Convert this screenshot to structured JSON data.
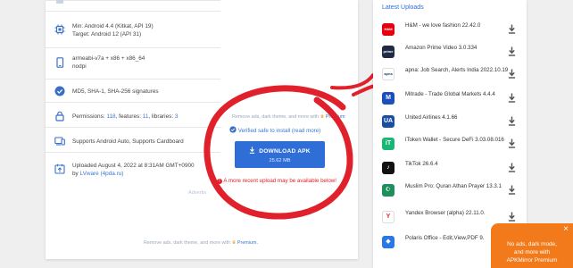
{
  "details": {
    "min_android": "Min: Android 4.4 (Kitkat, API 19)",
    "target_android": "Target: Android 12 (API 31)",
    "arch": "armeabi-v7a + x86 + x86_64",
    "dpi": "nodpi",
    "signatures": "MD5, SHA-1, SHA-256 signatures",
    "permissions_prefix": "Permissions: ",
    "permissions_count": "118",
    "features_prefix": ", features: ",
    "features_count": "11",
    "libraries_prefix": ", libraries: ",
    "libraries_count": "3",
    "auto": "Supports Android Auto, Supports Cardboard",
    "uploaded": "Uploaded August 4, 2022 at 8:31AM GMT+0900",
    "uploaded_by": "by LVware (4pda.ru)",
    "advert": "Advertis"
  },
  "download": {
    "remove_ads_top": "Remove ads, dark theme, and more with",
    "premium_top": "Premium",
    "verified": "Verified safe to install (read more)",
    "button_label": "DOWNLOAD APK",
    "file_size": "25.62 MB",
    "warning": "A more recent upload may be available below!",
    "remove_ads_bottom": "Remove ads, dark theme, and more with",
    "premium_bottom": "Premium."
  },
  "latest_uploads": {
    "title": "Latest Uploads",
    "items": [
      {
        "name": "H&M - we love fashion 22.42.0",
        "icon_text": "H&M",
        "color": "#e50010"
      },
      {
        "name": "Amazon Prime Video 3.0.334",
        "icon_text": "prime",
        "color": "#1f2a44"
      },
      {
        "name": "apna: Job Search, Alerts India 2022.10.19",
        "icon_text": "apna",
        "color": "#ffffff"
      },
      {
        "name": "Mitrade - Trade Global Markets 4.4.4",
        "icon_text": "M",
        "color": "#1b4fbb"
      },
      {
        "name": "United Airlines 4.1.66",
        "icon_text": "UA",
        "color": "#1a4ea0"
      },
      {
        "name": "iToken Wallet - Secure DeFi 3.03.08.016",
        "icon_text": "iT",
        "color": "#18b776"
      },
      {
        "name": "TikTok 26.6.4",
        "icon_text": "♪",
        "color": "#111111"
      },
      {
        "name": "Muslim Pro: Quran Athan Prayer 13.3.1",
        "icon_text": "☪",
        "color": "#1e8f5a"
      },
      {
        "name": "Yandex Browser (alpha) 22.11.0.",
        "icon_text": "Y",
        "color": "#ffffff"
      },
      {
        "name": "Polaris Office - Edit,View,PDF 9.",
        "icon_text": "◆",
        "color": "#2b78e4"
      }
    ]
  },
  "promo": {
    "line1": "No ads, dark mode,",
    "line2": "and more with",
    "line3": "APKMirror Premium",
    "close": "×"
  },
  "colors": {
    "accent": "#2f6ed6",
    "warning": "#e0232b",
    "promo": "#f27a1a"
  }
}
